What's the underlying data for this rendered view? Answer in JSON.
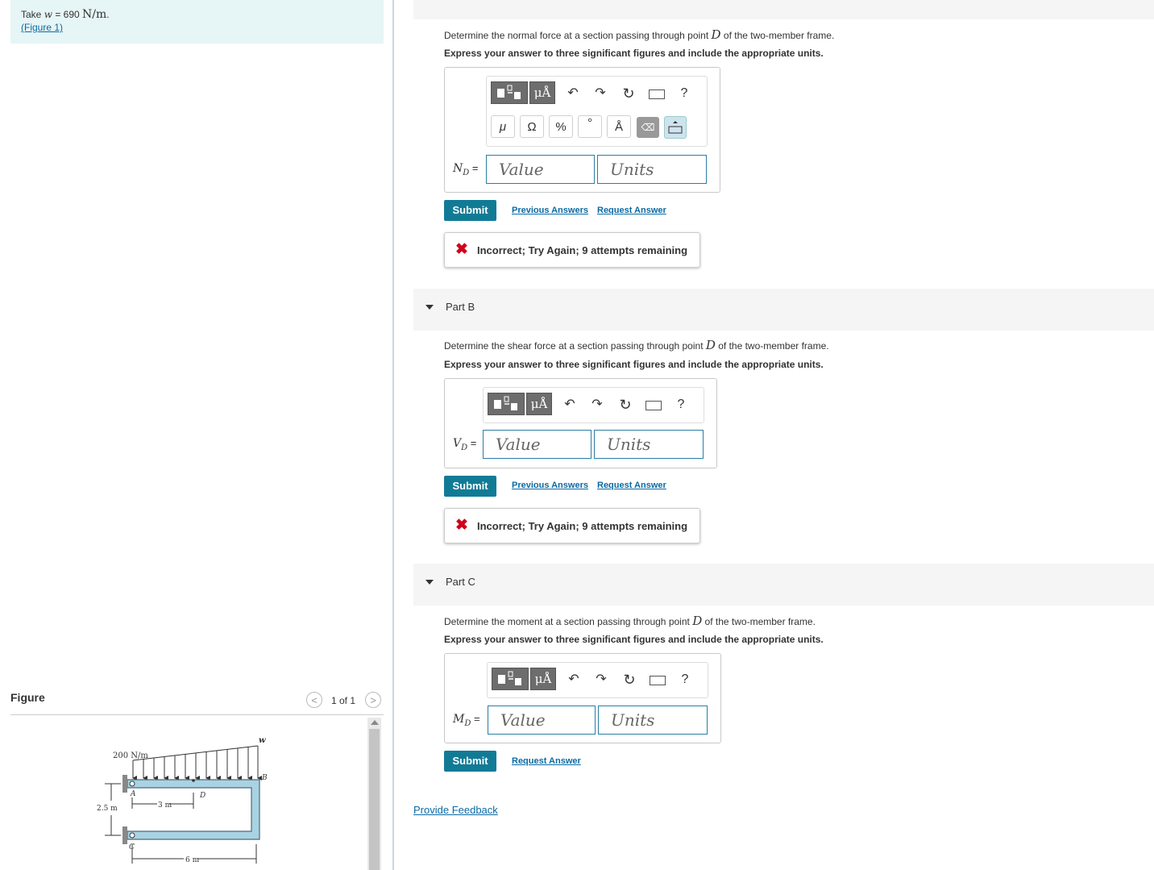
{
  "given": {
    "take": "Take",
    "w_symbol": "w",
    "equals_value": " = 690 ",
    "unit": "N/m",
    "period": ".",
    "figure_link": "(Figure 1)"
  },
  "figure_panel": {
    "title": "Figure",
    "pager_text": "1 of 1",
    "prev_glyph": "<",
    "next_glyph": ">",
    "labels": {
      "load": "200 N/m",
      "w": "w",
      "A": "A",
      "B": "B",
      "C": "C",
      "D": "D",
      "dim_3m": "3 m",
      "dim_6m": "6 m",
      "dim_25m": "2.5 m"
    }
  },
  "toolbar": {
    "mu_icon": "μÅ",
    "undo": "↶",
    "redo": "↷",
    "reset": "↻",
    "help": "?",
    "symbols": [
      "μ",
      "Ω",
      "%",
      "°",
      "Å"
    ],
    "delete": "⌫"
  },
  "part_a": {
    "question_pre": "Determine the normal force at a section passing through point ",
    "point": "D",
    "question_post": " of the two-member frame.",
    "instruction": "Express your answer to three significant figures and include the appropriate units.",
    "label_var": "N",
    "label_sub": "D",
    "label_eq": " =",
    "value_placeholder": "Value",
    "units_placeholder": "Units",
    "submit": "Submit",
    "previous_answers": "Previous Answers",
    "request_answer": "Request Answer",
    "feedback": "Incorrect; Try Again; 9 attempts remaining"
  },
  "part_b": {
    "header": "Part B",
    "question_pre": "Determine the shear force at a section passing through point ",
    "point": "D",
    "question_post": " of the two-member frame.",
    "instruction": "Express your answer to three significant figures and include the appropriate units.",
    "label_var": "V",
    "label_sub": "D",
    "label_eq": " =",
    "value_placeholder": "Value",
    "units_placeholder": "Units",
    "submit": "Submit",
    "previous_answers": "Previous Answers",
    "request_answer": "Request Answer",
    "feedback": "Incorrect; Try Again; 9 attempts remaining"
  },
  "part_c": {
    "header": "Part C",
    "question_pre": "Determine the moment at a section passing through point ",
    "point": "D",
    "question_post": " of the two-member frame.",
    "instruction": "Express your answer to three significant figures and include the appropriate units.",
    "label_var": "M",
    "label_sub": "D",
    "label_eq": " =",
    "value_placeholder": "Value",
    "units_placeholder": "Units",
    "submit": "Submit",
    "request_answer": "Request Answer"
  },
  "provide_feedback": "Provide Feedback",
  "colors": {
    "accent": "#117b96",
    "link": "#0b6aa4",
    "error": "#d0021b",
    "frame_fill": "#a9d3e3",
    "given_bg": "#e6f5f5"
  }
}
